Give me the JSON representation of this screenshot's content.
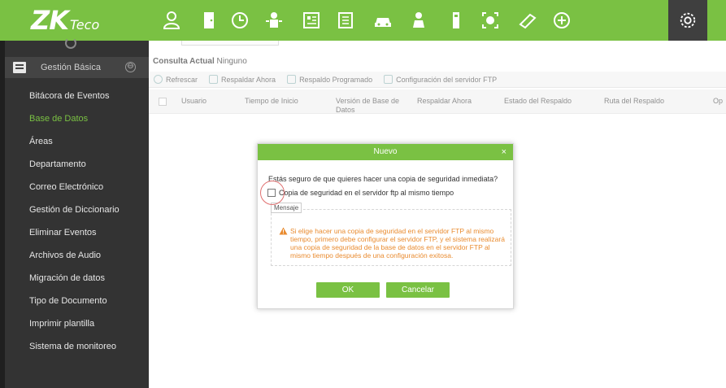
{
  "brand": {
    "logo_main": "ZK",
    "logo_sub": "Teco"
  },
  "topbar": {
    "icons": [
      "person-icon",
      "door-icon",
      "clock-icon",
      "elevator-icon",
      "visitor-icon",
      "parking-icon",
      "car-icon",
      "patrol-icon",
      "locker-icon",
      "face-icon",
      "video-icon",
      "plus-circle-icon",
      "gear-icon"
    ],
    "accent": "#7ac143"
  },
  "sidebar": {
    "header_label": "Gestión Básica",
    "collapse_glyph": "⊖",
    "items": [
      "Bitácora de Eventos",
      "Base de Datos",
      "Áreas",
      "Departamento",
      "Correo Electrónico",
      "Gestión de Diccionario",
      "Eliminar Eventos",
      "Archivos de Audio",
      "Migración de datos",
      "Tipo de Documento",
      "Imprimir plantilla",
      "Sistema de monitoreo"
    ],
    "active_index": 1
  },
  "main": {
    "consulta_label": "Consulta Actual",
    "consulta_value": "Ninguno",
    "toolbar": [
      "Refrescar",
      "Respaldar Ahora",
      "Respaldo Programado",
      "Configuración del servidor FTP"
    ],
    "table_headers": [
      "Usuario",
      "Tiempo de Inicio",
      "Versión de Base de Datos",
      "Respaldar Ahora",
      "Estado del Respaldo",
      "Ruta del Respaldo",
      "Op"
    ]
  },
  "modal": {
    "title": "Nuevo",
    "close": "×",
    "question": "Estás seguro de que quieres hacer una copia de seguridad inmediata?",
    "ftp_checkbox_label": "Copia de seguridad en el servidor ftp al mismo tiempo",
    "ftp_checked": false,
    "message_label": "Mensaje",
    "warning_text": "Si elige hacer una copia de seguridad en el servidor FTP al mismo tiempo, primero debe configurar el servidor FTP, y el sistema realizará una copia de seguridad de la base de datos en el servidor FTP al mismo tiempo después de una configuración exitosa.",
    "ok_label": "OK",
    "cancel_label": "Cancelar"
  }
}
